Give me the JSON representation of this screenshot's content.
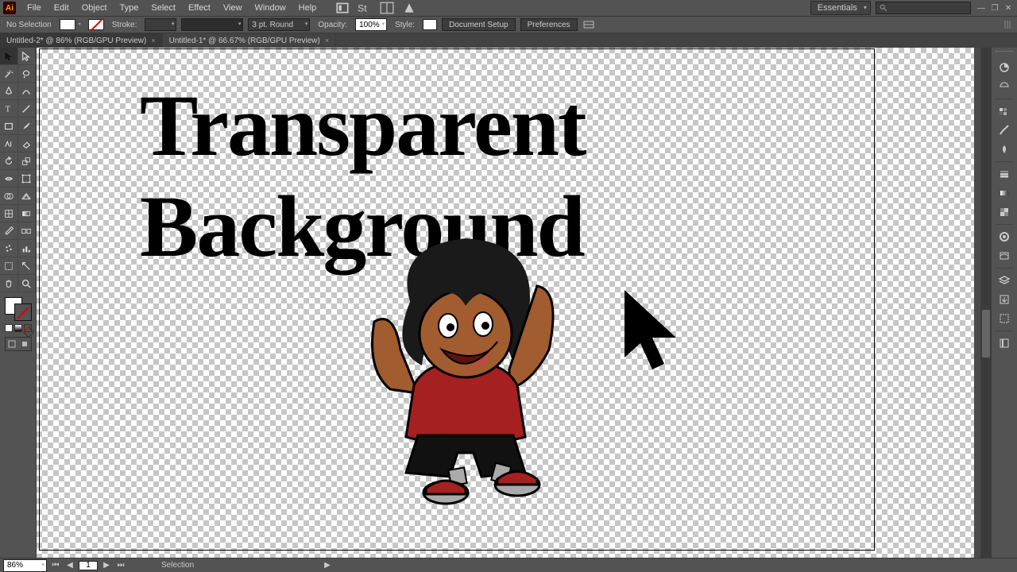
{
  "app_icon_label": "Ai",
  "menus": [
    "File",
    "Edit",
    "Object",
    "Type",
    "Select",
    "Effect",
    "View",
    "Window",
    "Help"
  ],
  "workspace": "Essentials",
  "controlbar": {
    "selection_state": "No Selection",
    "stroke_label": "Stroke:",
    "stroke_weight": "",
    "stroke_profile": "3 pt. Round",
    "opacity_label": "Opacity:",
    "opacity_value": "100%",
    "style_label": "Style:",
    "doc_setup": "Document Setup",
    "preferences": "Preferences"
  },
  "tabs": [
    {
      "label": "Untitled-2* @ 86% (RGB/GPU Preview)",
      "active": true
    },
    {
      "label": "Untitled-1* @ 66.67% (RGB/GPU Preview)",
      "active": false
    }
  ],
  "canvas": {
    "title_text": "Transparent Background"
  },
  "statusbar": {
    "zoom": "86%",
    "page": "1",
    "mode": "Selection"
  },
  "tools": [
    "selection-tool",
    "direct-selection-tool",
    "magic-wand-tool",
    "lasso-tool",
    "pen-tool",
    "curvature-tool",
    "type-tool",
    "line-segment-tool",
    "rectangle-tool",
    "paintbrush-tool",
    "shaper-tool",
    "eraser-tool",
    "rotate-tool",
    "scale-tool",
    "width-tool",
    "free-transform-tool",
    "shape-builder-tool",
    "perspective-grid-tool",
    "mesh-tool",
    "gradient-tool",
    "eyedropper-tool",
    "blend-tool",
    "symbol-sprayer-tool",
    "column-graph-tool",
    "artboard-tool",
    "slice-tool",
    "hand-tool",
    "zoom-tool"
  ],
  "dock_panels": [
    "color-panel",
    "color-guide-panel",
    "swatches-panel",
    "brushes-panel",
    "symbols-panel",
    "stroke-panel",
    "gradient-panel",
    "transparency-panel",
    "appearance-panel",
    "graphic-styles-panel",
    "layers-panel",
    "asset-export-panel",
    "artboards-panel",
    "libraries-panel"
  ]
}
